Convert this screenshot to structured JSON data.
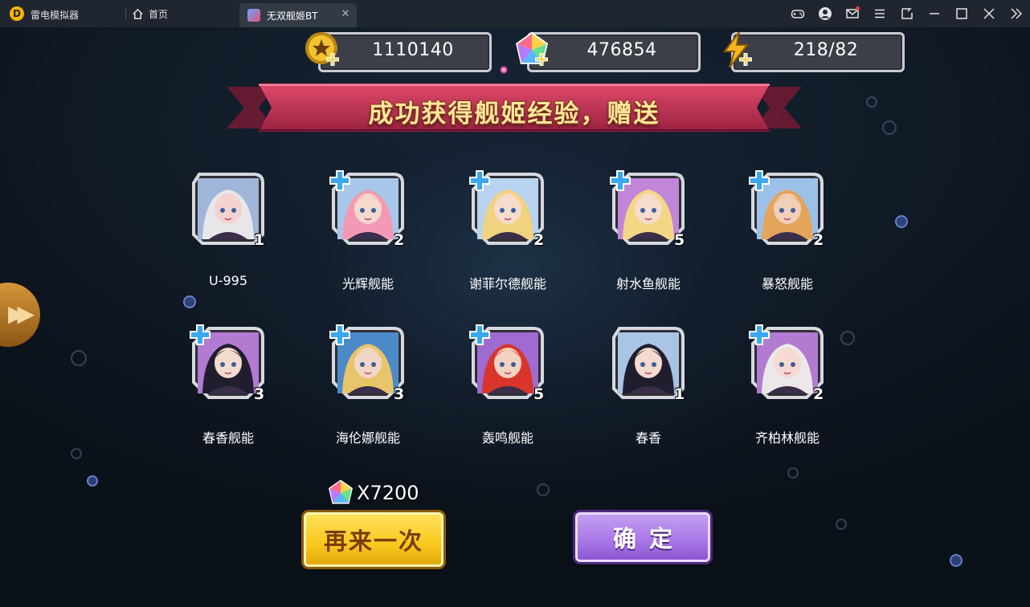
{
  "titlebar": {
    "app_name": "雷电模拟器",
    "home_tab": "首页",
    "game_tab": "无双舰姬BT",
    "tab_close": "✕",
    "icons": [
      "gamepad-icon",
      "user-icon",
      "mail-icon",
      "menu-icon",
      "resize-icon",
      "minimize-icon",
      "maximize-icon",
      "close-icon",
      "collapse-icon"
    ]
  },
  "currency": {
    "gold": "1110140",
    "gems": "476854",
    "energy": "218/82"
  },
  "banner": {
    "text": "成功获得舰姬经验，赠送"
  },
  "cards": [
    {
      "name": "U-995",
      "count": "1",
      "hair": "#e9e6ea",
      "bg": "#9fb6d8",
      "tone": "#f3d3cf"
    },
    {
      "name": "光辉舰能",
      "count": "2",
      "hair": "#f29ab5",
      "bg": "#a7c7ea",
      "tone": "#f6d8cd"
    },
    {
      "name": "谢菲尔德舰能",
      "count": "2",
      "hair": "#f1d27e",
      "bg": "#b8d3ef",
      "tone": "#f6dccd"
    },
    {
      "name": "射水鱼舰能",
      "count": "5",
      "hair": "#f4d784",
      "bg": "#c286d9",
      "tone": "#f5dccd"
    },
    {
      "name": "暴怒舰能",
      "count": "2",
      "hair": "#e4a45c",
      "bg": "#9cc1e8",
      "tone": "#f1cfb8"
    },
    {
      "name": "春香舰能",
      "count": "3",
      "hair": "#1f1d2e",
      "bg": "#b27ad0",
      "tone": "#f5dad0"
    },
    {
      "name": "海伦娜舰能",
      "count": "3",
      "hair": "#e8c56a",
      "bg": "#4c89c9",
      "tone": "#f3d6c6"
    },
    {
      "name": "轰鸣舰能",
      "count": "5",
      "hair": "#d9352b",
      "bg": "#9f6bd2",
      "tone": "#f3d2c2"
    },
    {
      "name": "春香",
      "count": "1",
      "hair": "#1f1d2e",
      "bg": "#a9c4e4",
      "tone": "#f5dad0"
    },
    {
      "name": "齐柏林舰能",
      "count": "2",
      "hair": "#ece8ea",
      "bg": "#b27ad0",
      "tone": "#f5d9d2"
    }
  ],
  "reward": {
    "text": "X7200",
    "icon": "gem-icon"
  },
  "buttons": {
    "again": "再来一次",
    "confirm": "确定"
  },
  "colors": {
    "frame_gold": "#d7b56a",
    "plus_badge": "#3aa8f0",
    "btn_yellow": "#f9c81d",
    "btn_purple": "#a776e6",
    "banner_red": "#c0314f"
  }
}
